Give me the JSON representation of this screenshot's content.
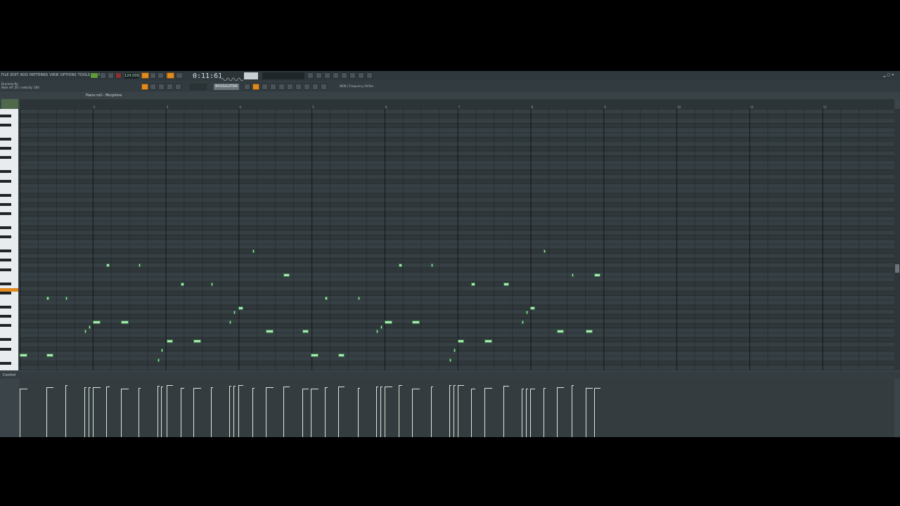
{
  "menu": [
    "FILE",
    "EDIT",
    "ADD",
    "PATTERNS",
    "VIEW",
    "OPTIONS",
    "TOOLS",
    "HELP"
  ],
  "transport": {
    "time": "0:11:61",
    "tempo": "124.000"
  },
  "file_info": {
    "filename": "Drumme.flp",
    "status": "Note off: D5 / velocity: 100"
  },
  "pattern_name": "BASSGUITAR",
  "channel_label": "NEW | Frequency Shifter",
  "piano_roll_title": "Piano roll - Morphine",
  "control_label": "Control",
  "bar_numbers": [
    "2",
    "3",
    "4",
    "5",
    "6",
    "7",
    "8",
    "9",
    "10",
    "11",
    "12"
  ],
  "colors": {
    "accent": "#e08a22",
    "note": "#a8e6b0",
    "grid_bg": "#363f43"
  }
}
